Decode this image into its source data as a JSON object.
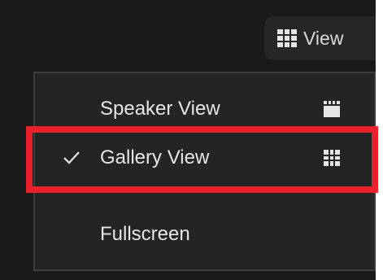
{
  "toolbar": {
    "view_label": "View",
    "view_icon": "grid-icon"
  },
  "menu": {
    "items": [
      {
        "label": "Speaker View",
        "icon": "speaker-view-icon",
        "checked": false
      },
      {
        "label": "Gallery View",
        "icon": "gallery-view-icon",
        "checked": true
      },
      {
        "label": "Fullscreen",
        "checked": false
      }
    ]
  },
  "colors": {
    "background": "#1a1a1a",
    "menu_background": "#242424",
    "menu_border": "#3c3c3c",
    "text": "#e6e6e6",
    "highlight": "#e8202a"
  }
}
